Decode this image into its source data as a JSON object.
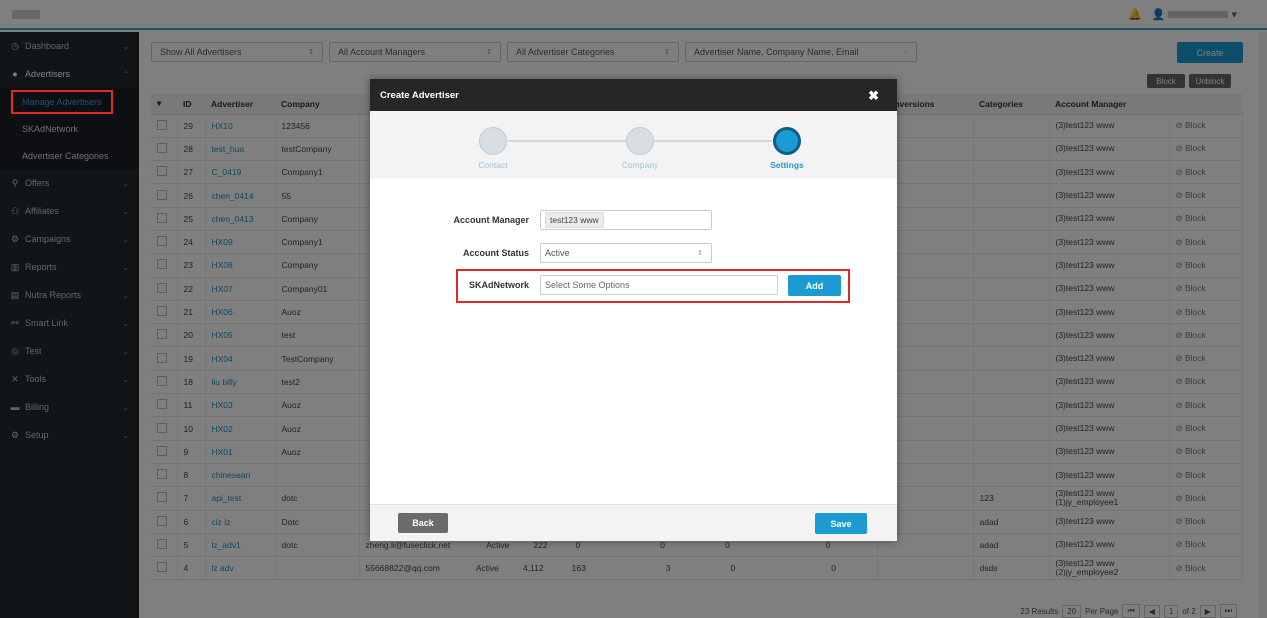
{
  "header": {
    "bell_icon": "bell-icon",
    "user_icon": "user-icon"
  },
  "sidebar": {
    "items": [
      {
        "label": "Dashboard",
        "icon": "dashboard-icon"
      },
      {
        "label": "Advertisers",
        "icon": "user-icon"
      },
      {
        "label": "Offers",
        "icon": "link-icon"
      },
      {
        "label": "Affiliates",
        "icon": "group-icon"
      },
      {
        "label": "Campaigns",
        "icon": "campaign-icon"
      },
      {
        "label": "Reports",
        "icon": "chart-icon"
      },
      {
        "label": "Nutra Reports",
        "icon": "report-icon"
      },
      {
        "label": "Smart Link",
        "icon": "smart-link-icon"
      },
      {
        "label": "Test",
        "icon": "test-icon"
      },
      {
        "label": "Tools",
        "icon": "tools-icon"
      },
      {
        "label": "Billing",
        "icon": "billing-icon"
      },
      {
        "label": "Setup",
        "icon": "setup-icon"
      }
    ],
    "sub_items": [
      "Manage Advertisers",
      "SKAdNetwork",
      "Advertiser Categories"
    ]
  },
  "filters": {
    "advertisers": "Show All Advertisers",
    "managers": "All Account Managers",
    "categories": "All Advertiser Categories",
    "search_placeholder": "Advertiser Name, Company Name, Email"
  },
  "toolbar": {
    "create": "Create",
    "block": "Block",
    "unblock": "Unblock"
  },
  "table": {
    "headers": [
      "ID",
      "Advertiser",
      "Company",
      "Conversions",
      "Categories",
      "Account Manager"
    ],
    "rows": [
      {
        "id": "29",
        "adv": "HX10",
        "company": "123456",
        "cat": "",
        "mgr": "(3)test123 www"
      },
      {
        "id": "28",
        "adv": "test_hua",
        "company": "testCompany",
        "cat": "",
        "mgr": "(3)test123 www"
      },
      {
        "id": "27",
        "adv": "C_0419",
        "company": "Company1",
        "cat": "",
        "mgr": "(3)test123 www"
      },
      {
        "id": "26",
        "adv": "chen_0414",
        "company": "55",
        "cat": "",
        "mgr": "(3)test123 www"
      },
      {
        "id": "25",
        "adv": "chen_0413",
        "company": "Company",
        "cat": "",
        "mgr": "(3)test123 www"
      },
      {
        "id": "24",
        "adv": "HX09",
        "company": "Company1",
        "cat": "",
        "mgr": "(3)test123 www"
      },
      {
        "id": "23",
        "adv": "HX08",
        "company": "Company",
        "cat": "",
        "mgr": "(3)test123 www"
      },
      {
        "id": "22",
        "adv": "HX07",
        "company": "Company01",
        "cat": "",
        "mgr": "(3)test123 www"
      },
      {
        "id": "21",
        "adv": "HX06",
        "company": "Auoz",
        "cat": "",
        "mgr": "(3)test123 www"
      },
      {
        "id": "20",
        "adv": "HX05",
        "company": "test",
        "cat": "",
        "mgr": "(3)test123 www"
      },
      {
        "id": "19",
        "adv": "HX04",
        "company": "TestCompany",
        "cat": "",
        "mgr": "(3)test123 www"
      },
      {
        "id": "18",
        "adv": "liu billy",
        "company": "test2",
        "cat": "",
        "mgr": "(3)test123 www"
      },
      {
        "id": "11",
        "adv": "HX03",
        "company": "Auoz",
        "cat": "",
        "mgr": "(3)test123 www"
      },
      {
        "id": "10",
        "adv": "HX02",
        "company": "Auoz",
        "cat": "",
        "mgr": "(3)test123 www"
      },
      {
        "id": "9",
        "adv": "HX01",
        "company": "Auoz",
        "cat": "",
        "mgr": "(3)test123 www"
      },
      {
        "id": "8",
        "adv": "chinesean",
        "company": "",
        "cat": "",
        "mgr": "(3)test123 www"
      },
      {
        "id": "7",
        "adv": "api_test",
        "company": "dotc",
        "cat": "123",
        "mgr": "(3)test123 www (1)jy_employee1"
      },
      {
        "id": "6",
        "adv": "ciz lz",
        "company": "Dotc",
        "cat": "adad",
        "mgr": "(3)test123 www"
      },
      {
        "id": "5",
        "adv": "lz_adv1",
        "company": "dotc",
        "cat": "adad",
        "mgr": "(3)test123 www"
      },
      {
        "id": "4",
        "adv": "lz adv",
        "company": "",
        "cat": "dsds",
        "mgr": "(3)test123 www (2)jy_employee2"
      }
    ],
    "extra_cols": [
      {
        "email": "zheng.li@fuseclick.net",
        "status": "Active",
        "a": "222",
        "b": "0",
        "c": "0",
        "d": "0",
        "e": "0"
      },
      {
        "email": "55668822@qq.com",
        "status": "Active",
        "a": "4,112",
        "b": "163",
        "c": "3",
        "d": "0",
        "e": "0"
      }
    ],
    "row_action": "Block"
  },
  "pagination": {
    "results": "23 Results",
    "per_page_value": "20",
    "per_page_label": "Per Page",
    "page": "1",
    "of": "of 2"
  },
  "modal": {
    "title": "Create Advertiser",
    "steps": [
      "Contact",
      "Company",
      "Settings"
    ],
    "account_manager_label": "Account Manager",
    "account_manager_tag": "test123 www",
    "account_status_label": "Account Status",
    "account_status_value": "Active",
    "skad_label": "SKAdNetwork",
    "skad_placeholder": "Select Some Options",
    "add": "Add",
    "back": "Back",
    "save": "Save"
  }
}
